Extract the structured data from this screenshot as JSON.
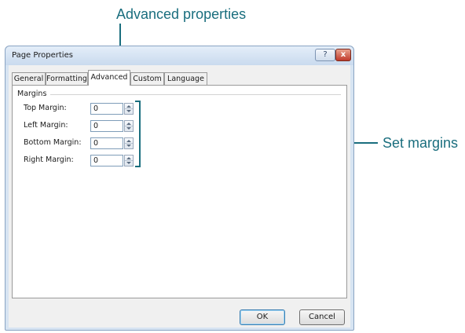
{
  "callouts": {
    "advanced": "Advanced properties",
    "margins": "Set margins"
  },
  "window": {
    "title": "Page Properties",
    "help_label": "?",
    "close_label": "x"
  },
  "tabs": [
    {
      "label": "General"
    },
    {
      "label": "Formatting"
    },
    {
      "label": "Advanced",
      "active": true
    },
    {
      "label": "Custom"
    },
    {
      "label": "Language"
    }
  ],
  "margins": {
    "group_label": "Margins",
    "fields": [
      {
        "label": "Top Margin:",
        "value": "0"
      },
      {
        "label": "Left Margin:",
        "value": "0"
      },
      {
        "label": "Bottom Margin:",
        "value": "0"
      },
      {
        "label": "Right Margin:",
        "value": "0"
      }
    ]
  },
  "buttons": {
    "ok": "OK",
    "cancel": "Cancel"
  },
  "colors": {
    "callout": "#1a6e7e",
    "close": "#c0392b"
  }
}
